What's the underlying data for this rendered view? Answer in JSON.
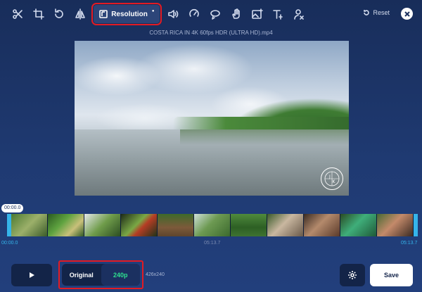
{
  "toolbar": {
    "tools": [
      {
        "name": "cut",
        "icon": "scissors-icon"
      },
      {
        "name": "crop",
        "icon": "crop-icon"
      },
      {
        "name": "rotate",
        "icon": "rotate-icon"
      },
      {
        "name": "flip",
        "icon": "flip-icon"
      }
    ],
    "resolution_label": "Resolution",
    "resolution_icon": "resolution-icon",
    "tools_after": [
      {
        "name": "volume",
        "icon": "volume-icon"
      },
      {
        "name": "speed",
        "icon": "speed-icon"
      },
      {
        "name": "loop",
        "icon": "loop-icon"
      },
      {
        "name": "stabilize",
        "icon": "hand-icon"
      },
      {
        "name": "add-image",
        "icon": "image-plus-icon"
      },
      {
        "name": "text",
        "icon": "text-icon"
      },
      {
        "name": "remove",
        "icon": "person-remove-icon"
      }
    ],
    "reset_label": "Reset"
  },
  "video": {
    "filename": "COSTA RICA IN 4K 60fps HDR (ULTRA HD).mp4",
    "watermark_icon": "jk-logo-icon"
  },
  "timeline": {
    "current_time": "00:00.0",
    "start_time": "00:00.0",
    "middle_time": "05:13.7",
    "end_time": "05:13.7",
    "thumbnail_count": 11,
    "accent_color": "#35b4ea"
  },
  "bottom": {
    "play_icon": "play-icon",
    "resolution_options": [
      "Original",
      "240p"
    ],
    "selected_resolution": "240p",
    "dimensions": "426x240",
    "settings_icon": "gear-icon",
    "save_label": "Save",
    "selected_color": "#2ee08f"
  }
}
